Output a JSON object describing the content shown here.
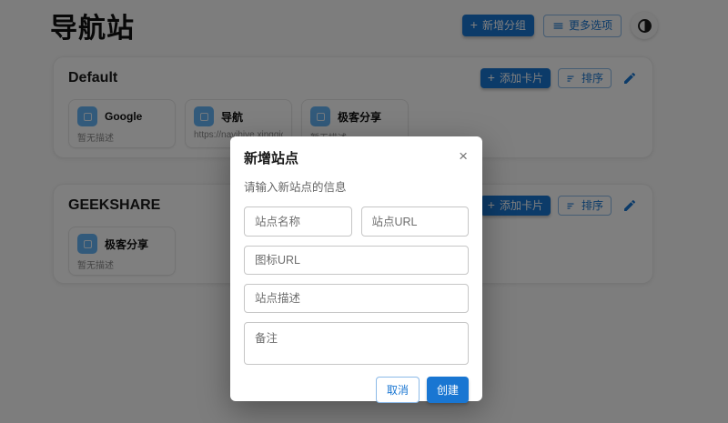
{
  "page": {
    "title": "导航站"
  },
  "icons": {
    "add": "+",
    "close": "×",
    "menu": "hamburger-lines",
    "sort": "sort-lines",
    "edit": "pencil",
    "theme": "dark-mode-toggle",
    "card_glyph": "favicon-placeholder"
  },
  "colors": {
    "primary": "#1976d2",
    "page_bg": "#fafafa",
    "card_icon_bg": "#64b5f6",
    "overlay": "rgba(0,0,0,0.5)"
  },
  "header": {
    "add_group": "新增分组",
    "more_options": "更多选项"
  },
  "sections": [
    {
      "title": "Default",
      "actions": {
        "add_card": "添加卡片",
        "sort": "排序"
      },
      "cards": [
        {
          "title": "Google",
          "subtitle": "暂无描述"
        },
        {
          "title": "导航",
          "subtitle": "https://navihive.xingqiong.i"
        },
        {
          "title": "极客分享",
          "subtitle": "暂无描述"
        }
      ]
    },
    {
      "title": "GEEKSHARE",
      "actions": {
        "add_card": "添加卡片",
        "sort": "排序"
      },
      "cards": [
        {
          "title": "极客分享",
          "subtitle": "暂无描述"
        }
      ]
    }
  ],
  "modal": {
    "title": "新增站点",
    "subtitle": "请输入新站点的信息",
    "close_glyph": "×",
    "fields": {
      "site_name": "站点名称",
      "site_url": "站点URL",
      "icon_url": "图标URL",
      "site_desc": "站点描述",
      "notes": "备注"
    },
    "cancel_label": "取消",
    "create_label": "创建"
  }
}
